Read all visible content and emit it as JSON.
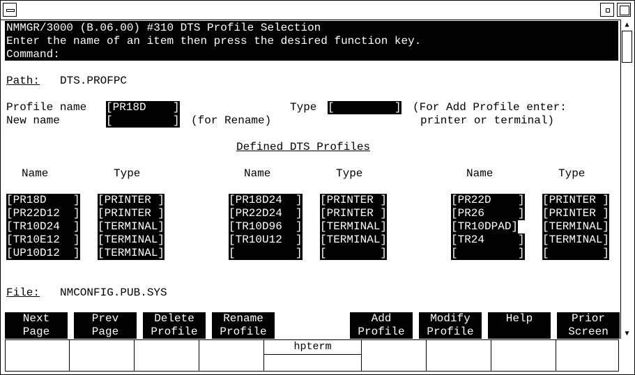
{
  "header": {
    "line1": "NMMGR/3000 (B.06.00) #310 DTS Profile Selection",
    "line2": "Enter the name of an item then press the desired function key.",
    "line3": "Command:"
  },
  "path": {
    "label": "Path:",
    "value": "DTS.PROFPC"
  },
  "form": {
    "profile_name_label": "Profile name",
    "profile_name_value": "[PR18D    ]",
    "new_name_label": "New name",
    "new_name_value": "[         ]",
    "for_rename": "(for Rename)",
    "type_label": "Type",
    "type_value": "[         ]",
    "add_note_1": "(For Add Profile enter:",
    "add_note_2": "printer or terminal)"
  },
  "defined_title": "Defined DTS Profiles",
  "columns": {
    "name": "Name",
    "type": "Type"
  },
  "profiles_col1": [
    {
      "name": "[PR18D    ]",
      "type": "[PRINTER ]"
    },
    {
      "name": "[PR22D12  ]",
      "type": "[PRINTER ]"
    },
    {
      "name": "[TR10D24  ]",
      "type": "[TERMINAL]"
    },
    {
      "name": "[TR10E12  ]",
      "type": "[TERMINAL]"
    },
    {
      "name": "[UP10D12  ]",
      "type": "[TERMINAL]"
    }
  ],
  "profiles_col2": [
    {
      "name": "[PR18D24  ]",
      "type": "[PRINTER ]"
    },
    {
      "name": "[PR22D24  ]",
      "type": "[PRINTER ]"
    },
    {
      "name": "[TR10D96  ]",
      "type": "[TERMINAL]"
    },
    {
      "name": "[TR10U12  ]",
      "type": "[TERMINAL]"
    },
    {
      "name": "[         ]",
      "type": "[        ]"
    }
  ],
  "profiles_col3": [
    {
      "name": "[PR22D    ]",
      "type": "[PRINTER ]"
    },
    {
      "name": "[PR26     ]",
      "type": "[PRINTER ]"
    },
    {
      "name": "[TR10DPAD]",
      "type": "[TERMINAL]"
    },
    {
      "name": "[TR24     ]",
      "type": "[TERMINAL]"
    },
    {
      "name": "[         ]",
      "type": "[        ]"
    }
  ],
  "file": {
    "label": "File:",
    "value": "NMCONFIG.PUB.SYS"
  },
  "function_keys": [
    {
      "line1": "Next",
      "line2": "Page"
    },
    {
      "line1": "Prev",
      "line2": "Page"
    },
    {
      "line1": "Delete",
      "line2": "Profile"
    },
    {
      "line1": "Rename",
      "line2": "Profile"
    },
    {
      "line1": "Add",
      "line2": "Profile"
    },
    {
      "line1": "Modify",
      "line2": "Profile"
    },
    {
      "line1": "Help",
      "line2": ""
    },
    {
      "line1": "Prior",
      "line2": "Screen"
    }
  ],
  "softkey_label": "hpterm"
}
